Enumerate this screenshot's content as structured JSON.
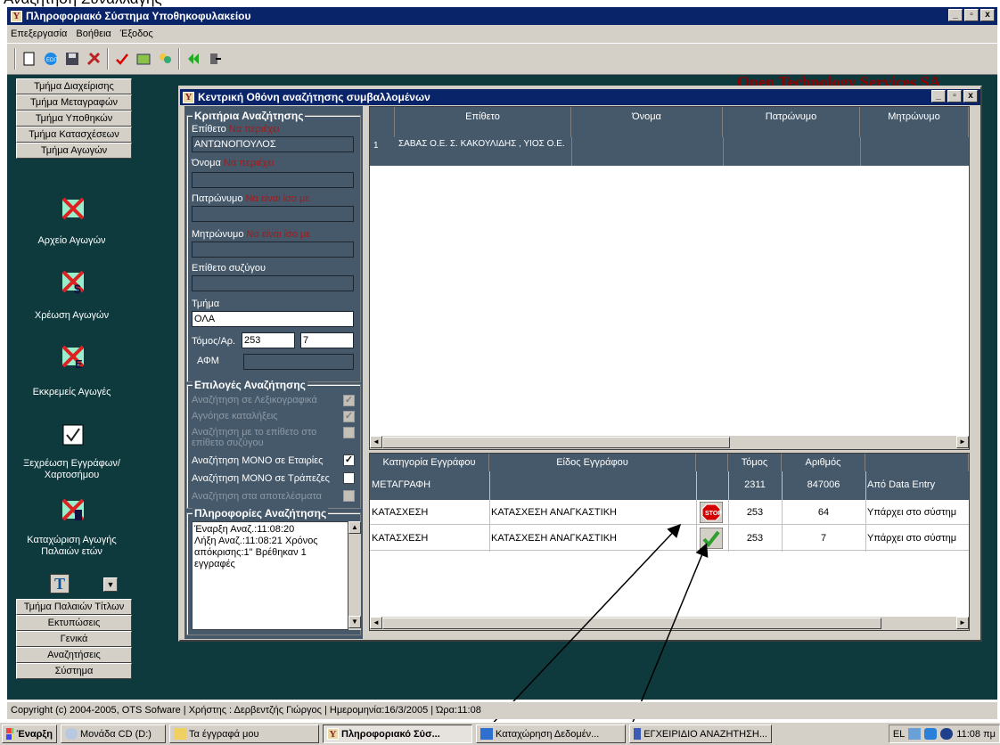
{
  "page_caption": "Αναζήτηση Συναλλαγής",
  "app": {
    "title": "Πληροφοριακό Σύστημα Υποθηκοφυλακείου",
    "icon_letter": "Y",
    "window_buttons": [
      "_",
      "▫",
      "x"
    ]
  },
  "menu": [
    "Επεξεργασία",
    "Βοήθεια",
    "Έξοδος"
  ],
  "toolbar_icons": [
    "new-document-icon",
    "edit-icon",
    "save-icon",
    "tools-icon",
    "check-icon",
    "report-icon",
    "users-icon",
    "back-icon",
    "exit-icon"
  ],
  "logo_text": "Open Technology Services SA",
  "sidebar": {
    "top_buttons": [
      "Τμήμα Διαχείρισης",
      "Τμήμα Μεταγραφών",
      "Τμήμα Υποθηκών",
      "Τμήμα Κατασχέσεων",
      "Τμήμα Αγωγών"
    ],
    "items": [
      {
        "label": "Αρχείο Αγωγών",
        "icon": "lawsuit-archive-icon"
      },
      {
        "label": "Χρέωση Αγωγών",
        "icon": "lawsuit-charge-icon"
      },
      {
        "label": "Εκκρεμείς Αγωγές",
        "icon": "pending-lawsuits-icon"
      },
      {
        "label": "Ξεχρέωση Εγγράφων/Χαρτοσήμου",
        "icon": "discharge-documents-icon"
      },
      {
        "label": "Καταχώριση Αγωγής Παλαιών ετών",
        "icon": "old-lawsuit-entry-icon"
      }
    ],
    "bottom_buttons": [
      "Τμήμα Παλαιών Τίτλων",
      "Εκτυπώσεις",
      "Γενικά",
      "Αναζητήσεις",
      "Σύστημα"
    ]
  },
  "search_window": {
    "title": "Κεντρική Οθόνη αναζήτησης συμβαλλομένων",
    "criteria": {
      "legend": "Κριτήρια Αναζήτησης",
      "surname_label": "Επίθετο",
      "surname_mode": "Να περιέχει",
      "surname_value": "ΑΝΤΩΝΟΠΟΥΛΟΣ",
      "name_label": "Όνομα",
      "name_mode": "Να περιέχει",
      "name_value": "",
      "father_label": "Πατρώνυμο",
      "father_mode": "Να είναι ίσο με",
      "father_value": "",
      "mother_label": "Μητρώνυμο",
      "mother_mode": "Να είναι ίσο με",
      "mother_value": "",
      "spouse_label": "Επίθετο συζύγου",
      "spouse_value": "",
      "dept_label": "Τμήμα",
      "dept_value": "ΟΛΑ",
      "volume_label": "Τόμος/Αρ.",
      "volume_value": "253",
      "number_value": "7",
      "afm_label": "ΑΦΜ",
      "afm_value": ""
    },
    "options": {
      "legend": "Επιλογές Αναζήτησης",
      "items": [
        {
          "label": "Αναζήτηση σε Λεξικογραφικά",
          "checked": true,
          "enabled": false
        },
        {
          "label": "Αγνόησε καταλήξεις",
          "checked": true,
          "enabled": false
        },
        {
          "label": "Αναζήτηση με το επίθετο στο",
          "checked": false,
          "enabled": false
        },
        {
          "label": "επίθετο συζύγου",
          "checked": false,
          "enabled": false
        },
        {
          "label": "Αναζήτηση ΜΟΝΟ σε Εταιρίες",
          "checked": true,
          "enabled": true
        },
        {
          "label": "Αναζήτηση ΜΟΝΟ σε Τράπεζες",
          "checked": false,
          "enabled": true
        },
        {
          "label": "Αναζήτηση στα αποτελέσματα",
          "checked": false,
          "enabled": false
        }
      ]
    },
    "info": {
      "legend": "Πληροφορίες Αναζήτησης",
      "text": "Έναρξη Αναζ.:11:08:20\nΛήξη Αναζ.:11:08:21 Χρόνος απόκρισης:1\" Βρέθηκαν 1 εγγραφές"
    },
    "results": {
      "columns": [
        "Επίθετο",
        "Όνομα",
        "Πατρώνυμο",
        "Μητρώνυμο"
      ],
      "rows": [
        {
          "num": "1",
          "surname": "ΣΑΒΑΣ Ο.Ε. Σ. ΚΑΚΟΥΛΙΔΗΣ , ΥΙΟΣ Ο.Ε.",
          "name": "",
          "father": "",
          "mother": ""
        }
      ]
    },
    "documents": {
      "columns": [
        "Κατηγορία Εγγράφου",
        "Είδος Εγγράφου",
        "",
        "Τόμος",
        "Αριθμός",
        ""
      ],
      "rows": [
        {
          "category": "ΜΕΤΑΓΡΑΦΗ",
          "type": "",
          "status_icon": "",
          "volume": "2311",
          "number": "847006",
          "note": "Από Data Entry"
        },
        {
          "category": "ΚΑΤΑΣΧΕΣΗ",
          "type": "ΚΑΤΑΣΧΕΣΗ ΑΝΑΓΚΑΣΤΙΚΗ",
          "status_icon": "stop-icon",
          "volume": "253",
          "number": "64",
          "note": "Υπάρχει στο σύστημ"
        },
        {
          "category": "ΚΑΤΑΣΧΕΣΗ",
          "type": "ΚΑΤΑΣΧΕΣΗ ΑΝΑΓΚΑΣΤΙΚΗ",
          "status_icon": "checkmark-icon",
          "volume": "253",
          "number": "7",
          "note": "Υπάρχει στο σύστημ"
        }
      ]
    }
  },
  "statusbar": {
    "text": "Copyright (c) 2004-2005, OTS Sofware   |   Χρήστης : Δερβεντζής Γιώργος   |   Ημερομηνία:16/3/2005   |   Ώρα:11:08"
  },
  "taskbar": {
    "start": "Έναρξη",
    "tasks": [
      "Μονάδα CD (D:)",
      "Τα έγγραφά μου",
      "Πληροφοριακό Σύσ...",
      "Καταχώρηση Δεδομέν...",
      "ΕΓΧΕΙΡΙΔΙΟ ΑΝΑΖΗΤΗΣΗ..."
    ],
    "lang": "EL",
    "clock": "11:08 πμ"
  },
  "colors": {
    "panel": "#45596b",
    "desktop": "#0e3a3e",
    "titlebar": "#0a246a",
    "logo": "#8b0000",
    "mode_text": "#a31a1a"
  }
}
